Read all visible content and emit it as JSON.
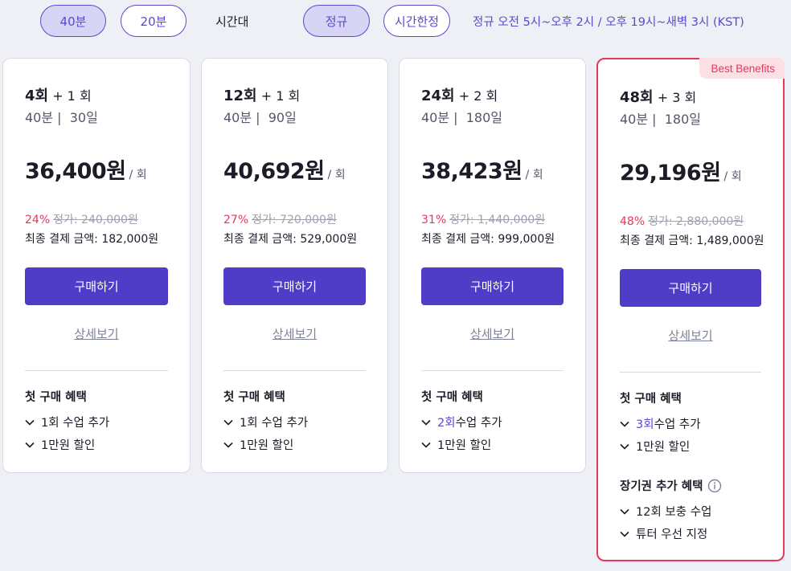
{
  "filters": {
    "duration_options": [
      "40분",
      "20분"
    ],
    "duration_selected": "40분",
    "time_label": "시간대",
    "time_options": [
      "정규",
      "시간한정"
    ],
    "time_selected": "정규",
    "schedule_note": "정규  오전 5시~오후 2시 / 오후 19시~새벽 3시 (KST)"
  },
  "colors": {
    "accent": "#4f3dc7",
    "accent_light": "#d8d4f5",
    "highlight": "#e8365c",
    "background": "#eef0f5"
  },
  "icons": {
    "benefit_bullet": "chevron-down-icon",
    "info": "info-icon"
  },
  "cards": [
    {
      "sessions": "4회",
      "bonus": "+ 1 회",
      "duration": "40분",
      "period": "30일",
      "price": "36,400원",
      "price_unit": "/ 회",
      "discount": "24%",
      "original": "정가: 240,000원",
      "final": "최종 결제 금액: 182,000원",
      "buy_label": "구매하기",
      "detail_label": "상세보기",
      "benefit_title": "첫 구매 혜택",
      "benefits": [
        {
          "highlight": "",
          "text": "1회 수업 추가"
        },
        {
          "highlight": "",
          "text": "1만원 할인"
        }
      ]
    },
    {
      "sessions": "12회",
      "bonus": "+ 1 회",
      "duration": "40분",
      "period": "90일",
      "price": "40,692원",
      "price_unit": "/ 회",
      "discount": "27%",
      "original": "정가: 720,000원",
      "final": "최종 결제 금액: 529,000원",
      "buy_label": "구매하기",
      "detail_label": "상세보기",
      "benefit_title": "첫 구매 혜택",
      "benefits": [
        {
          "highlight": "",
          "text": "1회 수업 추가"
        },
        {
          "highlight": "",
          "text": "1만원 할인"
        }
      ]
    },
    {
      "sessions": "24회",
      "bonus": "+ 2 회",
      "duration": "40분",
      "period": "180일",
      "price": "38,423원",
      "price_unit": "/ 회",
      "discount": "31%",
      "original": "정가: 1,440,000원",
      "final": "최종 결제 금액: 999,000원",
      "buy_label": "구매하기",
      "detail_label": "상세보기",
      "benefit_title": "첫 구매 혜택",
      "benefits": [
        {
          "highlight": "2회",
          "text": " 수업 추가"
        },
        {
          "highlight": "",
          "text": "1만원 할인"
        }
      ]
    },
    {
      "badge": "Best Benefits",
      "sessions": "48회",
      "bonus": "+ 3 회",
      "duration": "40분",
      "period": "180일",
      "price": "29,196원",
      "price_unit": "/ 회",
      "discount": "48%",
      "original": "정가: 2,880,000원",
      "final": "최종 결제 금액: 1,489,000원",
      "buy_label": "구매하기",
      "detail_label": "상세보기",
      "benefit_title": "첫 구매 혜택",
      "benefits": [
        {
          "highlight": "3회",
          "text": " 수업 추가"
        },
        {
          "highlight": "",
          "text": "1만원 할인"
        }
      ],
      "extra_title": "장기권 추가 혜택",
      "extra_benefits": [
        {
          "highlight": "",
          "text": "12회 보충 수업"
        },
        {
          "highlight": "",
          "text": "튜터 우선 지정"
        }
      ]
    }
  ]
}
